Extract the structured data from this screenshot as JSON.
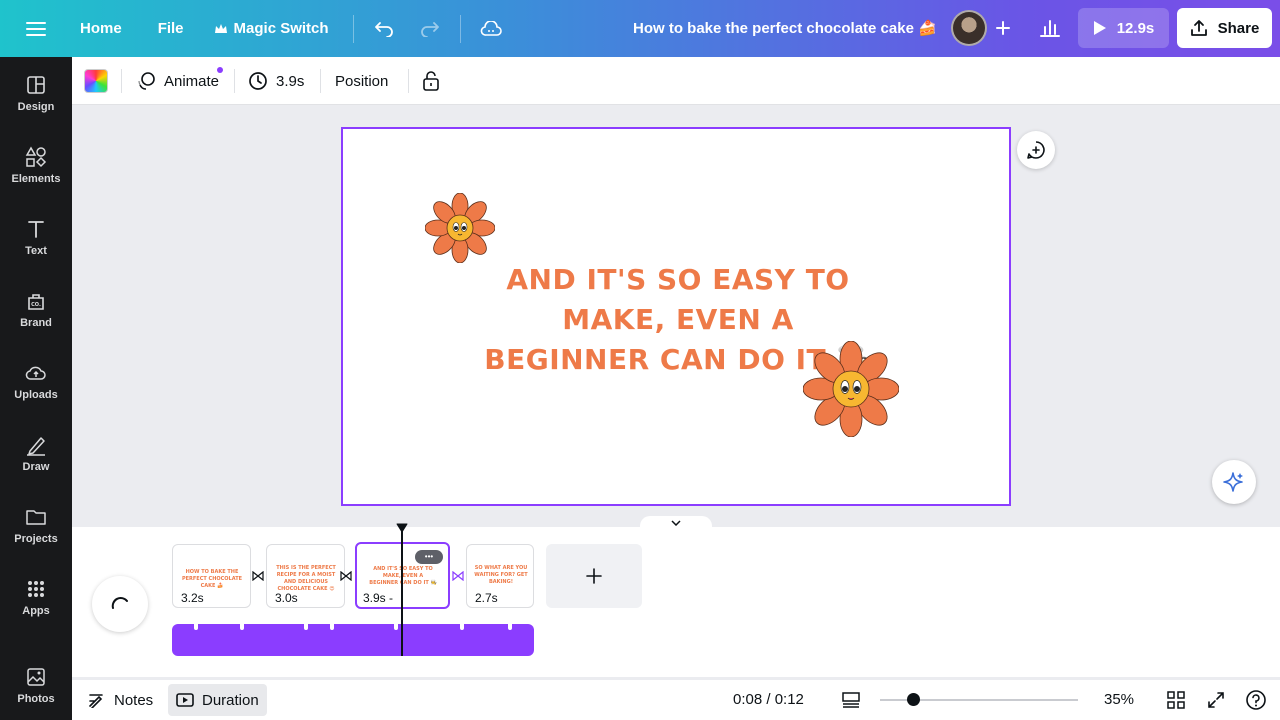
{
  "topbar": {
    "home_label": "Home",
    "file_label": "File",
    "magic_switch_label": "Magic Switch",
    "design_title": "How to bake the perfect chocolate cake 🍰",
    "play_label": "12.9s",
    "share_label": "Share",
    "icons": [
      "menu-icon",
      "crown-icon",
      "undo-icon",
      "redo-icon",
      "cloud-icon",
      "plus-icon",
      "bar-chart-icon",
      "play-icon",
      "upload-icon"
    ]
  },
  "sidebar": {
    "items": [
      {
        "label": "Design",
        "icon": "layout-icon"
      },
      {
        "label": "Elements",
        "icon": "shapes-icon"
      },
      {
        "label": "Text",
        "icon": "text-icon"
      },
      {
        "label": "Brand",
        "icon": "brand-icon"
      },
      {
        "label": "Uploads",
        "icon": "cloud-upload-icon"
      },
      {
        "label": "Draw",
        "icon": "pen-icon"
      },
      {
        "label": "Projects",
        "icon": "folder-icon"
      },
      {
        "label": "Apps",
        "icon": "grid-icon"
      },
      {
        "label": "Photos",
        "icon": "image-icon"
      }
    ]
  },
  "context_toolbar": {
    "animate_label": "Animate",
    "duration_label": "3.9s",
    "position_label": "Position"
  },
  "canvas": {
    "text_lines": [
      "AND IT'S SO EASY TO",
      "MAKE, EVEN A",
      "BEGINNER CAN DO IT 🧑‍🍳"
    ]
  },
  "timeline": {
    "pages": [
      {
        "duration": "3.2s",
        "preview": "HOW TO BAKE THE PERFECT CHOCOLATE CAKE 🍰"
      },
      {
        "duration": "3.0s",
        "preview": "THIS IS THE PERFECT RECIPE FOR A MOIST AND DELICIOUS CHOCOLATE CAKE 😍"
      },
      {
        "duration": "3.9s -",
        "preview": "AND IT'S SO EASY TO MAKE, EVEN A BEGINNER CAN DO IT 🧑‍🍳"
      },
      {
        "duration": "2.7s",
        "preview": "SO WHAT ARE YOU WAITING FOR? GET BAKING!"
      }
    ],
    "more_label": "•••"
  },
  "bottombar": {
    "notes_label": "Notes",
    "duration_label": "Duration",
    "time_display": "0:08 / 0:12",
    "zoom_value": 35,
    "zoom_label": "35%"
  },
  "colors": {
    "accent": "#8b3dff",
    "slide_text": "#ee7a48",
    "sidebar_bg": "#18191b"
  }
}
